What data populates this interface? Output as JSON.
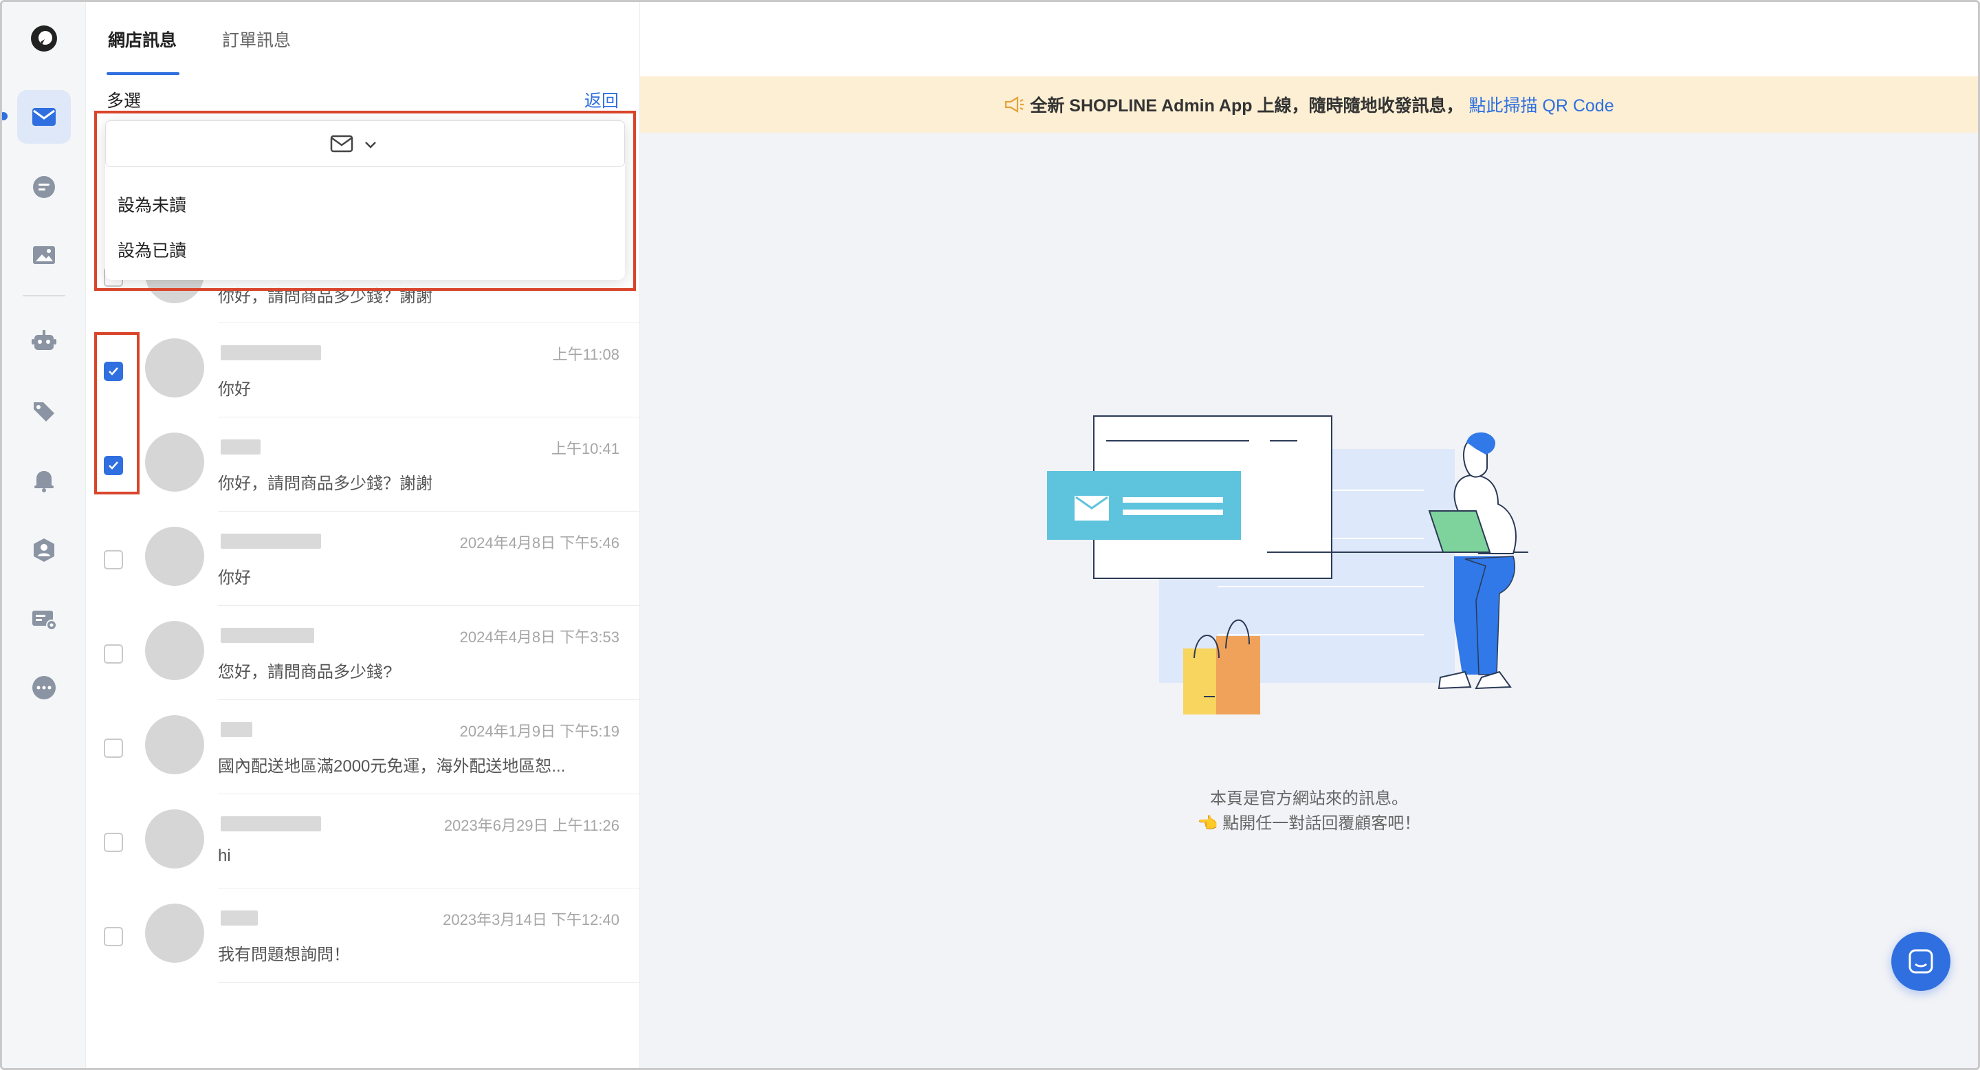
{
  "tabs": [
    {
      "label": "網店訊息",
      "active": true
    },
    {
      "label": "訂單訊息",
      "active": false
    }
  ],
  "list_header": {
    "multi_select_label": "多選",
    "back_label": "返回"
  },
  "dropdown": {
    "items": [
      "設為未讀",
      "設為已讀"
    ]
  },
  "conversations": [
    {
      "time": "",
      "message": "你好，請問商品多少錢？謝謝",
      "checked": false
    },
    {
      "time": "上午11:08",
      "message": "你好",
      "checked": true
    },
    {
      "time": "上午10:41",
      "message": "你好，請問商品多少錢？謝謝",
      "checked": true
    },
    {
      "time": "2024年4月8日 下午5:46",
      "message": "你好",
      "checked": false
    },
    {
      "time": "2024年4月8日 下午3:53",
      "message": "您好，請問商品多少錢?",
      "checked": false
    },
    {
      "time": "2024年1月9日 下午5:19",
      "message": "國內配送地區滿2000元免運，海外配送地區恕...",
      "checked": false
    },
    {
      "time": "2023年6月29日 上午11:26",
      "message": "hi",
      "checked": false
    },
    {
      "time": "2023年3月14日 下午12:40",
      "message": "我有問題想詢問！",
      "checked": false
    }
  ],
  "banner": {
    "text": "全新 SHOPLINE Admin App 上線，隨時隨地收發訊息，",
    "link": "點此掃描 QR Code"
  },
  "empty_state": {
    "line1": "本頁是官方網站來的訊息。",
    "line2": "👈 點開任一對話回覆顧客吧！"
  },
  "colors": {
    "accent": "#2f6fe0",
    "highlight": "#d9452b",
    "banner_bg": "#fcefd4"
  },
  "icons": [
    "app-logo-icon",
    "mail-icon",
    "chat-icon",
    "image-icon",
    "bot-icon",
    "tag-icon",
    "bell-icon",
    "team-icon",
    "ticket-icon",
    "more-icon",
    "megaphone-icon",
    "chevron-down-icon",
    "messenger-icon"
  ]
}
